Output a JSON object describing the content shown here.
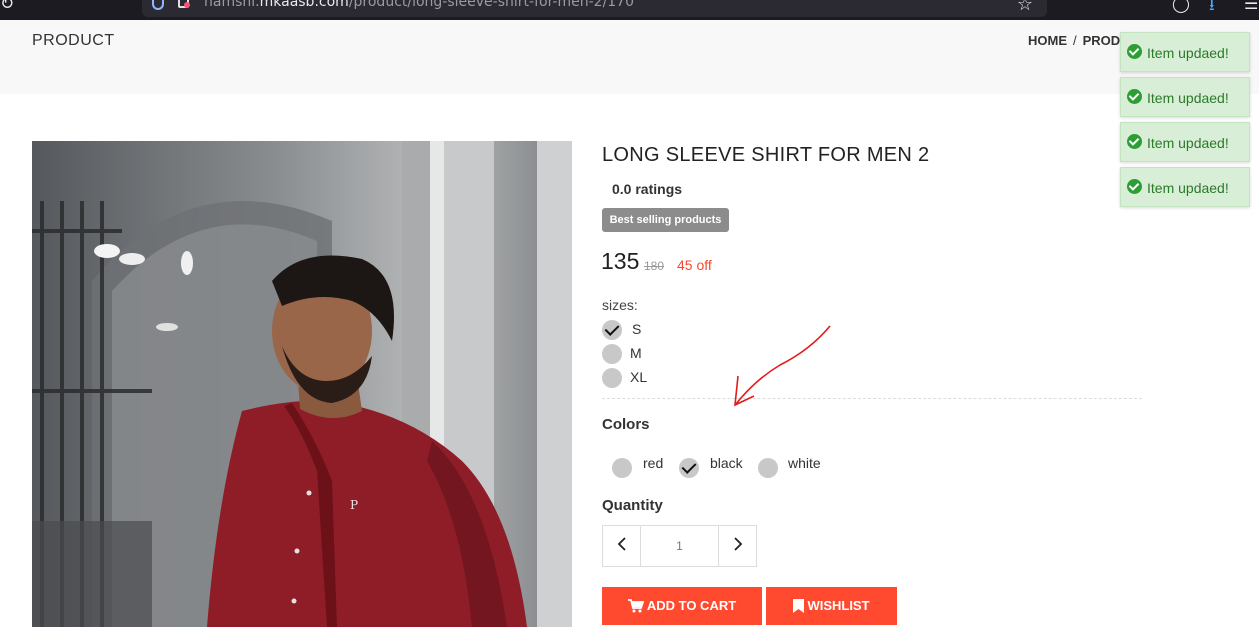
{
  "browser": {
    "url_prefix": "namshi.",
    "url_domain": "mkaasb.com",
    "url_path": "/product/long-sleeve-shirt-for-men-2/170"
  },
  "header": {
    "title": "PRODUCT",
    "breadcrumb": {
      "home": "HOME",
      "separator": "/",
      "current": "PRODU"
    }
  },
  "toasts": [
    {
      "message": "Item updaed!"
    },
    {
      "message": "Item updaed!"
    },
    {
      "message": "Item updaed!"
    },
    {
      "message": "Item updaed!"
    }
  ],
  "product": {
    "name": "LONG SLEEVE SHIRT FOR MEN 2",
    "ratings": "0.0 ratings",
    "badge": "Best selling products",
    "price": "135",
    "old_price": "180",
    "discount": "45 off",
    "sizes_label": "sizes:",
    "sizes": [
      {
        "label": "S",
        "checked": true
      },
      {
        "label": "M",
        "checked": false
      },
      {
        "label": "XL",
        "checked": false
      }
    ],
    "colors_label": "Colors",
    "colors": [
      {
        "label": "red",
        "checked": false
      },
      {
        "label": "black",
        "checked": true
      },
      {
        "label": "white",
        "checked": false
      }
    ],
    "quantity_label": "Quantity",
    "quantity": "1",
    "add_to_cart": "ADD TO CART",
    "wishlist": "WISHLIST"
  },
  "colors": {
    "accent": "#ff4a30",
    "badge": "#8c8c8c",
    "toast_bg": "#d9eed7",
    "toast_text": "#2a7a2a",
    "annotation": "#e31b1b",
    "shirt": "#8e1d27"
  }
}
